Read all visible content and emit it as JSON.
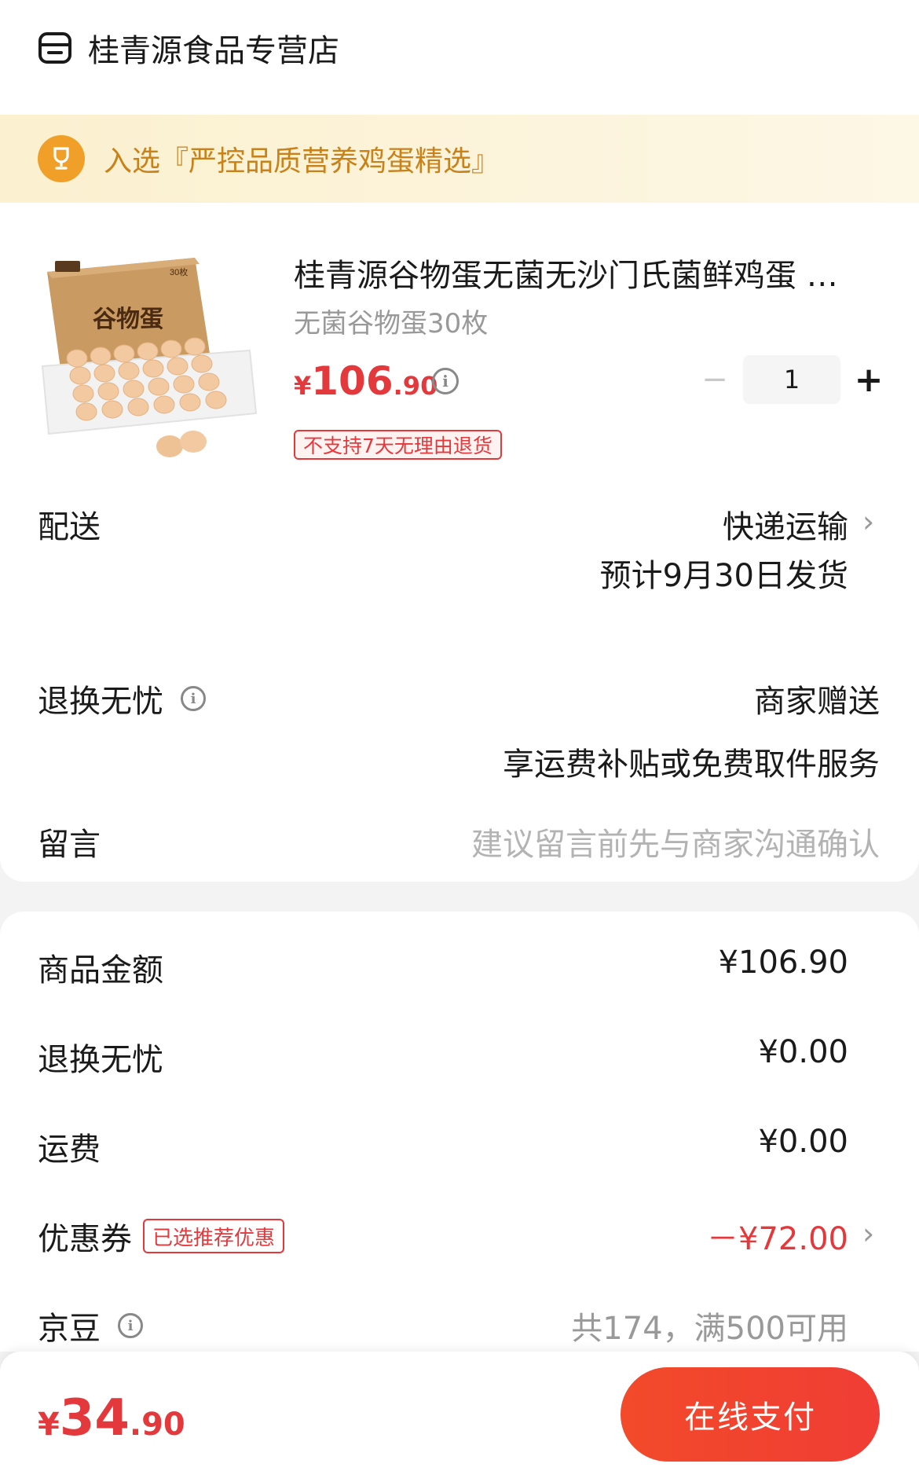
{
  "store": {
    "name": "桂青源食品专营店"
  },
  "banner": {
    "text": "入选『严控品质营养鸡蛋精选』"
  },
  "product": {
    "title": "桂青源谷物蛋无菌无沙门氏菌鲜鸡蛋 …",
    "spec": "无菌谷物蛋30枚",
    "price_currency": "¥",
    "price_int": "106",
    "price_dec": ".90",
    "quantity": "1",
    "minus": "−",
    "plus": "+",
    "tag": "不支持7天无理由退货",
    "box_label": "谷物蛋",
    "box_count": "30枚"
  },
  "delivery": {
    "label": "配送",
    "method": "快递运输",
    "eta": "预计9月30日发货"
  },
  "return_service": {
    "label": "退换无忧",
    "value": "商家赠送",
    "desc": "享运费补贴或免费取件服务"
  },
  "message": {
    "label": "留言",
    "placeholder": "建议留言前先与商家沟通确认"
  },
  "summary": {
    "goods_label": "商品金额",
    "goods_value": "¥106.90",
    "return_label": "退换无忧",
    "return_value": "¥0.00",
    "shipping_label": "运费",
    "shipping_value": "¥0.00",
    "coupon_label": "优惠券",
    "coupon_tag": "已选推荐优惠",
    "coupon_value": "－¥72.00",
    "jd_label": "京豆",
    "jd_value": "共174，满500可用"
  },
  "footer": {
    "total_currency": "¥",
    "total_int": "34",
    "total_dec": ".90",
    "pay_label": "在线支付"
  },
  "colors": {
    "accent": "#e4393c",
    "banner_text": "#c9821a",
    "trophy": "#f0a028"
  }
}
